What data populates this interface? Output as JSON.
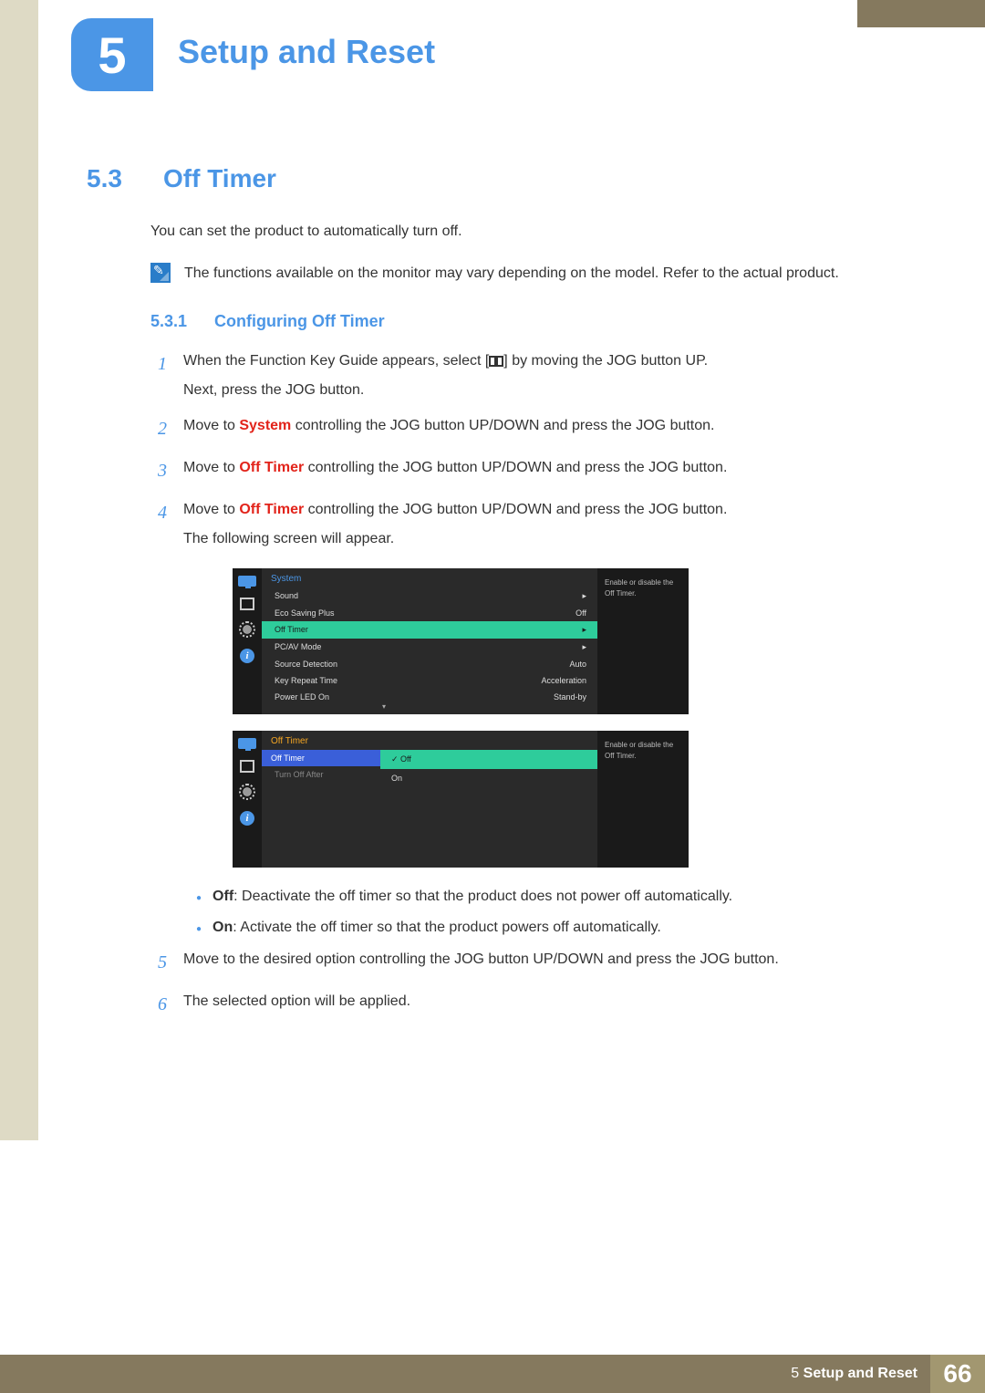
{
  "chapter": {
    "num": "5",
    "title": "Setup and Reset"
  },
  "section": {
    "num": "5.3",
    "title": "Off Timer"
  },
  "intro": "You can set the product to automatically turn off.",
  "note": "The functions available on the monitor may vary depending on the model. Refer to the actual product.",
  "subsection": {
    "num": "5.3.1",
    "title": "Configuring Off Timer"
  },
  "steps": {
    "s1a": "When the Function Key Guide appears, select [",
    "s1b": "] by moving the JOG button UP.",
    "s1c": "Next, press the JOG button.",
    "s2a": "Move to ",
    "s2kw": "System",
    "s2b": " controlling the JOG button UP/DOWN and press the JOG button.",
    "s3a": "Move to ",
    "s3kw": "Off Timer",
    "s3b": " controlling the JOG button UP/DOWN and press the JOG button.",
    "s4a": "Move to ",
    "s4kw": "Off Timer",
    "s4b": " controlling the JOG button UP/DOWN and press the JOG button.",
    "s4c": "The following screen will appear.",
    "s5": "Move to the desired option controlling the JOG button UP/DOWN and press the JOG button.",
    "s6": "The selected option will be applied."
  },
  "nums": {
    "n1": "1",
    "n2": "2",
    "n3": "3",
    "n4": "4",
    "n5": "5",
    "n6": "6"
  },
  "osd1": {
    "header": "System",
    "desc": "Enable or disable the Off Timer.",
    "items": [
      {
        "label": "Sound",
        "value": "",
        "arrow": true
      },
      {
        "label": "Eco Saving Plus",
        "value": "Off",
        "arrow": false
      },
      {
        "label": "Off Timer",
        "value": "",
        "arrow": true,
        "sel": true
      },
      {
        "label": "PC/AV Mode",
        "value": "",
        "arrow": true
      },
      {
        "label": "Source Detection",
        "value": "Auto",
        "arrow": false
      },
      {
        "label": "Key Repeat Time",
        "value": "Acceleration",
        "arrow": false
      },
      {
        "label": "Power LED On",
        "value": "Stand-by",
        "arrow": false
      }
    ]
  },
  "osd2": {
    "header": "Off Timer",
    "desc": "Enable or disable the Off Timer.",
    "left": [
      {
        "label": "Off Timer",
        "sel": true
      },
      {
        "label": "Turn Off After"
      }
    ],
    "options": [
      {
        "label": "Off",
        "sel": true
      },
      {
        "label": "On"
      }
    ]
  },
  "bullets": {
    "off_kw": "Off",
    "off_t": ": Deactivate the off timer so that the product does not power off automatically.",
    "on_kw": "On",
    "on_t": ": Activate the off timer so that the product powers off automatically."
  },
  "footer": {
    "text": "Setup and Reset",
    "page": "66",
    "chap": "5"
  }
}
